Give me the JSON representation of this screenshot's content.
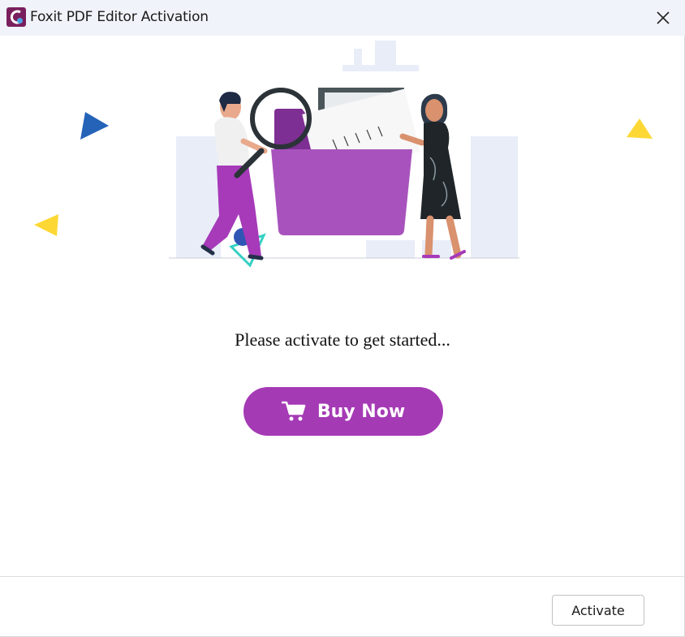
{
  "window": {
    "title": "Foxit PDF Editor Activation",
    "app_icon": "foxit-logo-icon",
    "close_icon": "close-icon"
  },
  "main": {
    "message": "Please activate to get started...",
    "buy_button": {
      "label": "Buy Now",
      "icon": "cart-icon"
    }
  },
  "footer": {
    "activate_button": {
      "label": "Activate"
    }
  },
  "colors": {
    "accent": "#a53ab5",
    "titlebar": "#f0f3f9",
    "decor_blue": "#2563b8",
    "decor_yellow": "#fdd835",
    "decor_teal": "#35d0c4"
  }
}
